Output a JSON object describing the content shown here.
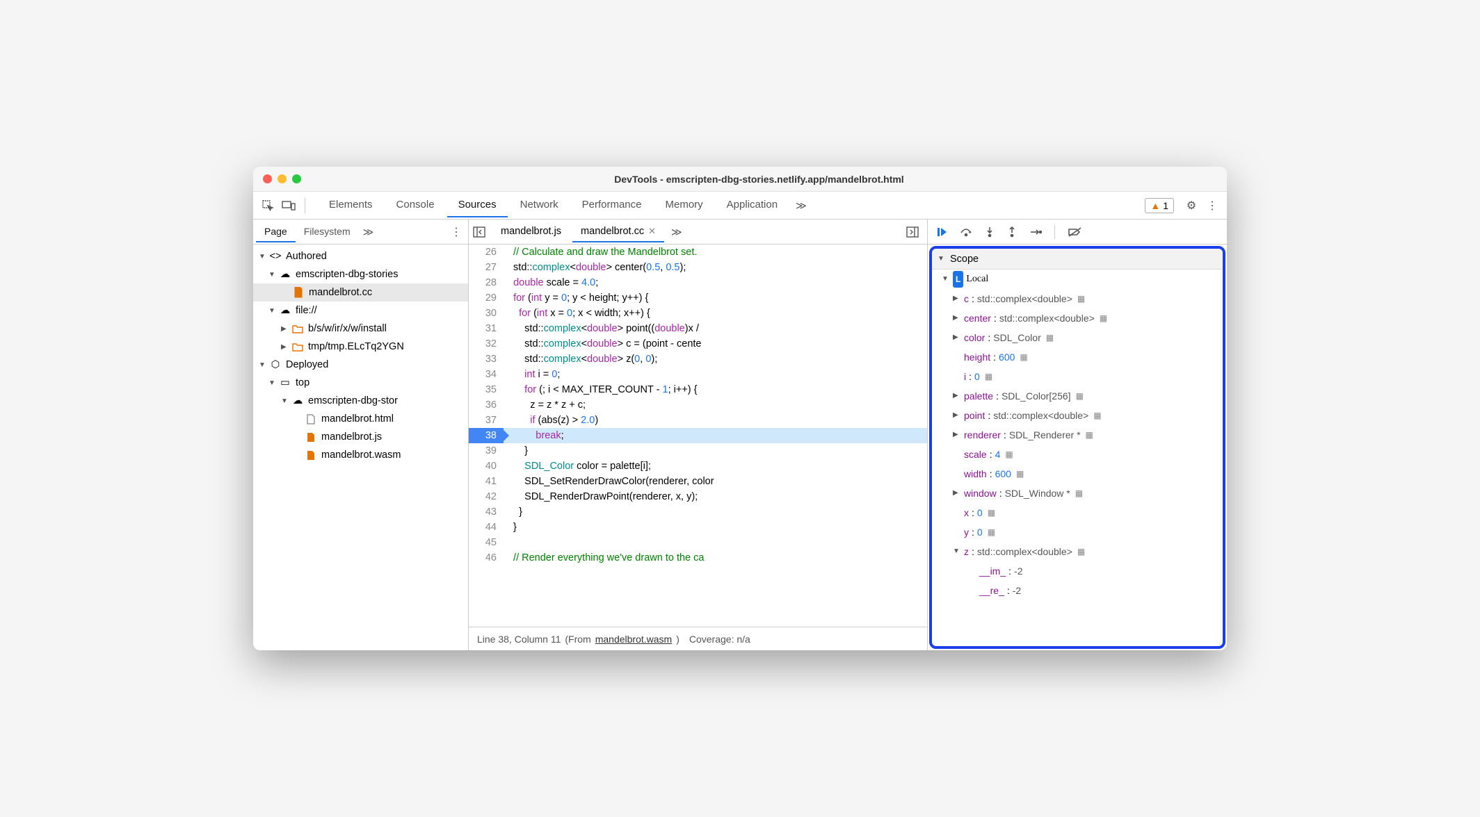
{
  "title": "DevTools - emscripten-dbg-stories.netlify.app/mandelbrot.html",
  "toolbar": {
    "tabs": [
      "Elements",
      "Console",
      "Sources",
      "Network",
      "Performance",
      "Memory",
      "Application"
    ],
    "active": "Sources",
    "warn_count": "1"
  },
  "sidebar": {
    "tabs": [
      "Page",
      "Filesystem"
    ],
    "active": "Page",
    "tree": {
      "authored": "Authored",
      "origin1": "emscripten-dbg-stories",
      "file_cc": "mandelbrot.cc",
      "fileproto": "file://",
      "folder1": "b/s/w/ir/x/w/install",
      "folder2": "tmp/tmp.ELcTq2YGN",
      "deployed": "Deployed",
      "top": "top",
      "origin2": "emscripten-dbg-stor",
      "file_html": "mandelbrot.html",
      "file_js": "mandelbrot.js",
      "file_wasm": "mandelbrot.wasm"
    }
  },
  "editor": {
    "tabs": [
      "mandelbrot.js",
      "mandelbrot.cc"
    ],
    "active": "mandelbrot.cc",
    "status_line": "Line 38, Column 11",
    "status_from": "(From ",
    "status_src": "mandelbrot.wasm",
    "status_end": ")",
    "coverage": "Coverage: n/a"
  },
  "code": [
    {
      "n": 26,
      "cls": "com",
      "t": "  // Calculate and draw the Mandelbrot set."
    },
    {
      "n": 27,
      "t": "  std::<span class=typ>complex</span>&lt;<span class=kw>double</span>&gt; center(<span class=num>0.5</span>, <span class=num>0.5</span>);"
    },
    {
      "n": 28,
      "t": "  <span class=kw>double</span> scale = <span class=num>4.0</span>;"
    },
    {
      "n": 29,
      "t": "  <span class=kw>for</span> (<span class=kw>int</span> y = <span class=num>0</span>; y &lt; height; y++) {"
    },
    {
      "n": 30,
      "t": "    <span class=kw>for</span> (<span class=kw>int</span> x = <span class=num>0</span>; x &lt; width; x++) {"
    },
    {
      "n": 31,
      "t": "      std::<span class=typ>complex</span>&lt;<span class=kw>double</span>&gt; point((<span class=kw>double</span>)x /"
    },
    {
      "n": 32,
      "t": "      std::<span class=typ>complex</span>&lt;<span class=kw>double</span>&gt; c = (point - cente"
    },
    {
      "n": 33,
      "t": "      std::<span class=typ>complex</span>&lt;<span class=kw>double</span>&gt; z(<span class=num>0</span>, <span class=num>0</span>);"
    },
    {
      "n": 34,
      "t": "      <span class=kw>int</span> i = <span class=num>0</span>;"
    },
    {
      "n": 35,
      "t": "      <span class=kw>for</span> (; i &lt; MAX_ITER_COUNT - <span class=num>1</span>; i++) {"
    },
    {
      "n": 36,
      "t": "        z = z * z + c;"
    },
    {
      "n": 37,
      "t": "        <span class=kw>if</span> (abs(z) &gt; <span class=num>2.0</span>)"
    },
    {
      "n": 38,
      "bp": true,
      "t": "          <span class=kw>break</span>;"
    },
    {
      "n": 39,
      "t": "      }"
    },
    {
      "n": 40,
      "t": "      <span class=typ>SDL_Color</span> color = palette[i];"
    },
    {
      "n": 41,
      "t": "      SDL_SetRenderDrawColor(renderer, color"
    },
    {
      "n": 42,
      "t": "      SDL_RenderDrawPoint(renderer, x, y);"
    },
    {
      "n": 43,
      "t": "    }"
    },
    {
      "n": 44,
      "t": "  }"
    },
    {
      "n": 45,
      "t": ""
    },
    {
      "n": 46,
      "cls": "com",
      "t": "  // Render everything we've drawn to the ca"
    }
  ],
  "scope": {
    "header": "Scope",
    "local": "Local",
    "vars": [
      {
        "exp": true,
        "n": "c",
        "t": "std::complex<double>",
        "mem": true
      },
      {
        "exp": true,
        "n": "center",
        "t": "std::complex<double>",
        "mem": true
      },
      {
        "exp": true,
        "n": "color",
        "t": "SDL_Color",
        "mem": true
      },
      {
        "n": "height",
        "v": "600",
        "mem": true
      },
      {
        "n": "i",
        "v": "0",
        "mem": true
      },
      {
        "exp": true,
        "n": "palette",
        "t": "SDL_Color[256]",
        "mem": true
      },
      {
        "exp": true,
        "n": "point",
        "t": "std::complex<double>",
        "mem": true
      },
      {
        "exp": true,
        "n": "renderer",
        "t": "SDL_Renderer *",
        "mem": true
      },
      {
        "n": "scale",
        "v": "4",
        "mem": true
      },
      {
        "n": "width",
        "v": "600",
        "mem": true
      },
      {
        "exp": true,
        "n": "window",
        "t": "SDL_Window *",
        "mem": true
      },
      {
        "n": "x",
        "v": "0",
        "mem": true
      },
      {
        "n": "y",
        "v": "0",
        "mem": true
      },
      {
        "exp": true,
        "open": true,
        "n": "z",
        "t": "std::complex<double>",
        "mem": true,
        "children": [
          {
            "n": "__im_",
            "v": "-2"
          },
          {
            "n": "__re_",
            "v": "-2"
          }
        ]
      }
    ]
  }
}
